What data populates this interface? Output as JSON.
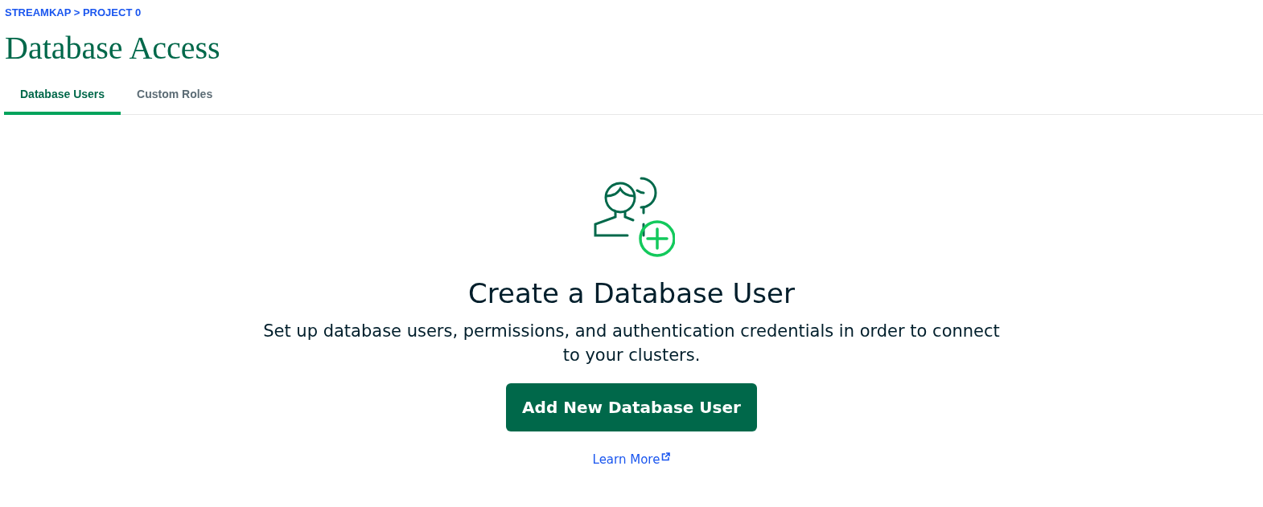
{
  "breadcrumb": "STREAMKAP > PROJECT 0",
  "title": "Database Access",
  "tabs": [
    {
      "label": "Database Users",
      "selected": true
    },
    {
      "label": "Custom Roles",
      "selected": false
    }
  ],
  "empty_state": {
    "heading": "Create a Database User",
    "description": "Set up database users, permissions, and authentication credentials in order to connect to your clusters.",
    "button": "Add New Database User",
    "link": "Learn More"
  }
}
